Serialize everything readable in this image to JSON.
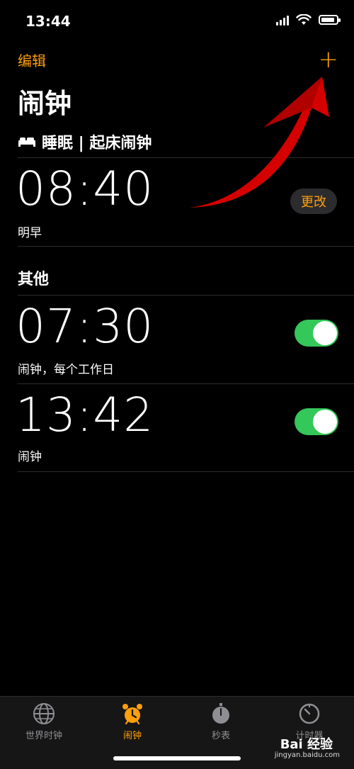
{
  "status_bar": {
    "time": "13:44"
  },
  "nav": {
    "edit_label": "编辑",
    "add_symbol": "+"
  },
  "page": {
    "title": "闹钟"
  },
  "sleep": {
    "header": "睡眠 | 起床闹钟",
    "alarm": {
      "time": "08:40",
      "label": "明早",
      "change_label": "更改"
    }
  },
  "other": {
    "title": "其他",
    "alarms": [
      {
        "time": "07:30",
        "label": "闹钟，每个工作日",
        "enabled": true
      },
      {
        "time": "13:42",
        "label": "闹钟",
        "enabled": true
      }
    ]
  },
  "tabs": [
    {
      "label": "世界时钟",
      "icon": "globe-icon",
      "active": false
    },
    {
      "label": "闹钟",
      "icon": "alarm-clock-icon",
      "active": true
    },
    {
      "label": "秒表",
      "icon": "stopwatch-icon",
      "active": false
    },
    {
      "label": "计时器",
      "icon": "timer-icon",
      "active": false
    }
  ],
  "watermark": {
    "text": "Bai 经验",
    "sub": "jingyan.baidu.com"
  },
  "colors": {
    "accent": "#FF9F0A",
    "toggle_on": "#34C759",
    "background": "#000000",
    "annotation_arrow": "#E00000"
  }
}
